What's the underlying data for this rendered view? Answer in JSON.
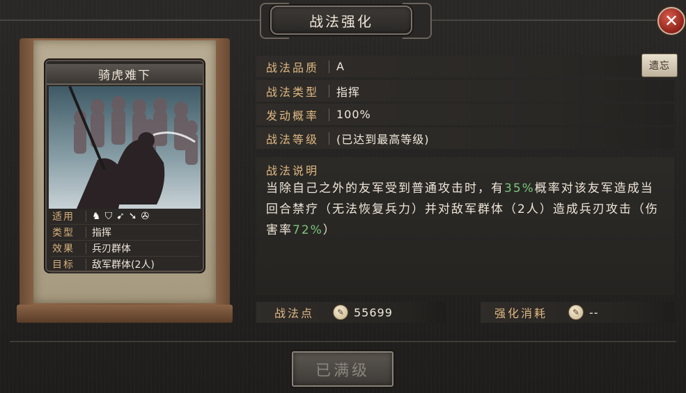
{
  "window": {
    "title": "战法强化"
  },
  "card": {
    "name": "骑虎难下",
    "rows": [
      {
        "label": "适用",
        "icons": [
          "cavalry-icon",
          "shield-icon",
          "bow-icon",
          "spear-icon",
          "chariot-icon"
        ]
      },
      {
        "label": "类型",
        "value": "指挥"
      },
      {
        "label": "效果",
        "value": "兵刃群体"
      },
      {
        "label": "目标",
        "value": "敌军群体(2人)"
      }
    ]
  },
  "info": {
    "quality_label": "战法品质",
    "quality_value": "A",
    "type_label": "战法类型",
    "type_value": "指挥",
    "rate_label": "发动概率",
    "rate_value": "100%",
    "level_label": "战法等级",
    "level_value": "(已达到最高等级)",
    "reset_label": "遗忘"
  },
  "description": {
    "title": "战法说明",
    "part1": "当除自己之外的友军受到普通攻击时，有",
    "pct1": "35%",
    "part2": "概率对该友军造成当回合禁疗（无法恢复兵力）并对敌军群体（2人）造成兵刃攻击（伤害率",
    "pct2": "72%",
    "part3": "）"
  },
  "points": {
    "label": "战法点",
    "value": "55699",
    "cost_label": "强化消耗",
    "cost_value": "--"
  },
  "action": {
    "max_label": "已满级"
  },
  "colors": {
    "accent": "#e0b883",
    "highlight": "#7ac77a",
    "close": "#c0392b"
  }
}
